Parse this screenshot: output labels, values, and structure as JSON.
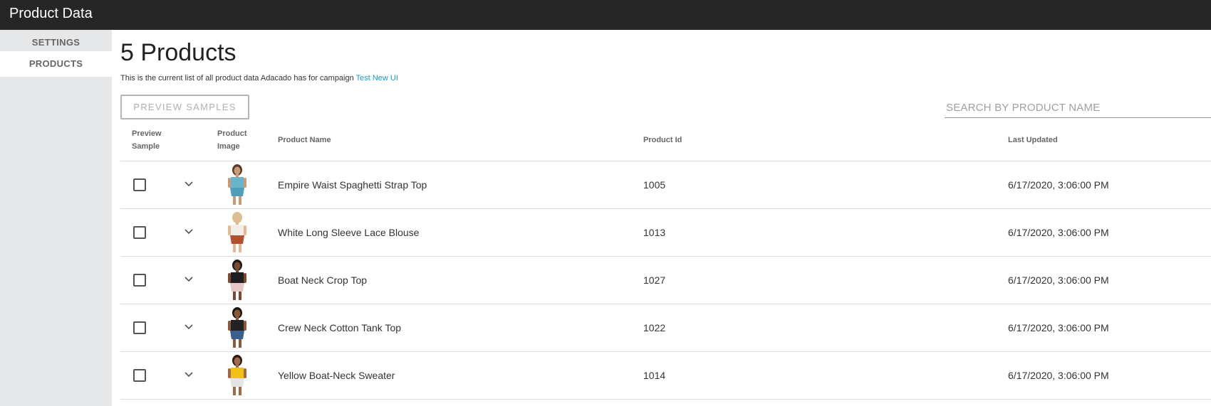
{
  "header": {
    "title": "Product Data"
  },
  "sidebar": {
    "items": [
      {
        "label": "SETTINGS",
        "active": false
      },
      {
        "label": "PRODUCTS",
        "active": true
      }
    ]
  },
  "main": {
    "title": "5 Products",
    "subtitle_text": "This is the current list of all product data Adacado has for campaign",
    "campaign_link": "Test New UI",
    "preview_button": "PREVIEW SAMPLES",
    "search_placeholder": "SEARCH BY PRODUCT NAME"
  },
  "table": {
    "headers": {
      "preview": "Preview Sample",
      "image": "Product Image",
      "name": "Product Name",
      "id": "Product Id",
      "updated": "Last Updated"
    },
    "rows": [
      {
        "name": "Empire Waist Spaghetti Strap Top",
        "id": "1005",
        "updated": "6/17/2020, 3:06:00 PM",
        "top_color": "#6ab4c9",
        "bottom_color": "#4f9fb8",
        "skin": "#c99a78",
        "hair": "#5a3a24"
      },
      {
        "name": "White Long Sleeve Lace Blouse",
        "id": "1013",
        "updated": "6/17/2020, 3:06:00 PM",
        "top_color": "#f3efe8",
        "bottom_color": "#b0522f",
        "skin": "#e2b896",
        "hair": "#d9c28a"
      },
      {
        "name": "Boat Neck Crop Top",
        "id": "1027",
        "updated": "6/17/2020, 3:06:00 PM",
        "top_color": "#1e1e1e",
        "bottom_color": "#e6c6c6",
        "skin": "#7a4b33",
        "hair": "#1a1a1a"
      },
      {
        "name": "Crew Neck Cotton Tank Top",
        "id": "1022",
        "updated": "6/17/2020, 3:06:00 PM",
        "top_color": "#222222",
        "bottom_color": "#3a5f8f",
        "skin": "#8a5a3c",
        "hair": "#1c1410"
      },
      {
        "name": "Yellow Boat-Neck Sweater",
        "id": "1014",
        "updated": "6/17/2020, 3:06:00 PM",
        "top_color": "#f2c118",
        "bottom_color": "#e4e4e4",
        "skin": "#a06a48",
        "hair": "#2a1a10"
      }
    ]
  }
}
